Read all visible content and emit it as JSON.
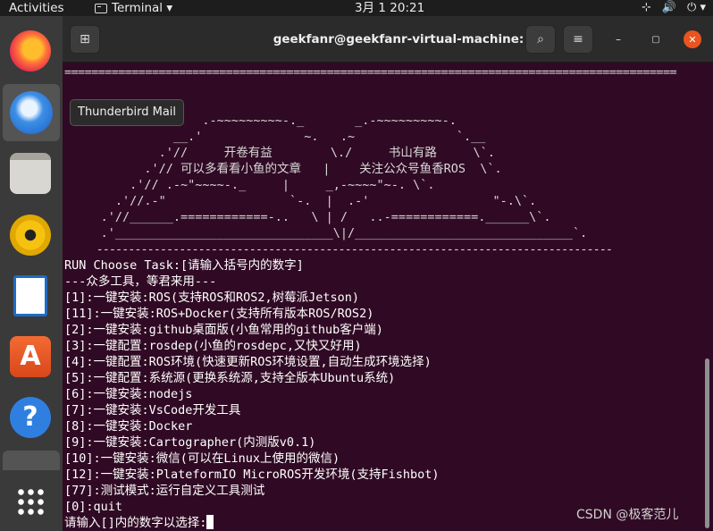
{
  "topbar": {
    "activities": "Activities",
    "app_name": "Terminal ▾",
    "clock": "3月 1  20:21",
    "tray": [
      "⊹",
      "🔊",
      "⏻ ▾"
    ]
  },
  "dock": {
    "items": [
      "firefox-icon",
      "thunderbird-icon",
      "files-icon",
      "rhythmbox-icon",
      "libreoffice-writer-icon",
      "software-icon",
      "help-icon",
      "terminal-icon",
      "show-apps-icon"
    ],
    "tooltip": "Thunderbird Mail"
  },
  "window": {
    "title": "geekfanr@geekfanr-virtual-machine: ~",
    "new_tab_label": "⊞",
    "search_label": "⌕",
    "menu_label": "≡",
    "minimize": "–",
    "maximize": "▢",
    "close": "✕"
  },
  "terminal": {
    "banner": [
      "===========================================================================================",
      "                   .-~~~~~~~~~-._       _.-~~~~~~~~~-.",
      "               __.'              ~.   .~              `.__",
      "             .'//     开卷有益        \\./     书山有路     \\`.",
      "           .'// 可以多看看小鱼的文章   |    关注公众号鱼香ROS  \\`.",
      "         .'// .-~\"~~~~-._     |     _,-~~~~\"~-. \\`.",
      "       .'//.-\"                 `-.  |  .-'                 \"-.\\`.",
      "     .'//______.============-..   \\ | /   ..-============.______\\`.",
      "     .'______________________________\\|/______________________________`.",
      "     ---------------------------------------------------------------------------------"
    ],
    "lines": [
      "RUN Choose Task:[请输入括号内的数字]",
      "---众多工具，等君来用---",
      "[1]:一键安装:ROS(支持ROS和ROS2,树莓派Jetson)",
      "[11]:一键安装:ROS+Docker(支持所有版本ROS/ROS2)",
      "[2]:一键安装:github桌面版(小鱼常用的github客户端)",
      "[3]:一键配置:rosdep(小鱼的rosdepc,又快又好用)",
      "[4]:一键配置:ROS环境(快速更新ROS环境设置,自动生成环境选择)",
      "[5]:一键配置:系统源(更换系统源,支持全版本Ubuntu系统)",
      "[6]:一键安装:nodejs",
      "[7]:一键安装:VsCode开发工具",
      "[8]:一键安装:Docker",
      "[9]:一键安装:Cartographer(内测版v0.1)",
      "[10]:一键安装:微信(可以在Linux上使用的微信)",
      "[12]:一键安装:PlateformIO MicroROS开发环境(支持Fishbot)",
      "[77]:测试模式:运行自定义工具测试",
      "[0]:quit"
    ],
    "prompt": "请输入[]内的数字以选择:"
  },
  "watermark": "CSDN @极客范儿"
}
